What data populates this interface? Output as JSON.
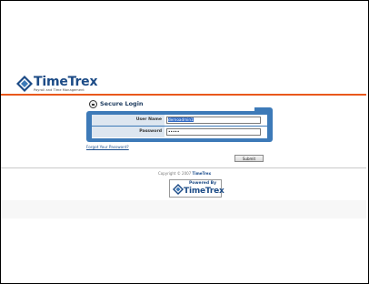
{
  "header": {
    "logo_text": "TimeTrex",
    "logo_tagline": "Payroll and Time Management",
    "accent_color": "#e9581c",
    "brand_color": "#1c4b86"
  },
  "login": {
    "title": "Secure Login",
    "title_icon": "lock-icon",
    "username_label": "User Name",
    "username_value": "demoadmin1",
    "password_label": "Password",
    "password_value": "•••••",
    "forgot_password": "Forgot Your Password?",
    "submit_label": "Submit",
    "panel_color": "#3d7ab8"
  },
  "footer": {
    "copyright_prefix": "Copyright © 2007",
    "copyright_link": "TimeTrex",
    "powered_by": "Powered By",
    "powered_brand": "TimeTrex"
  }
}
